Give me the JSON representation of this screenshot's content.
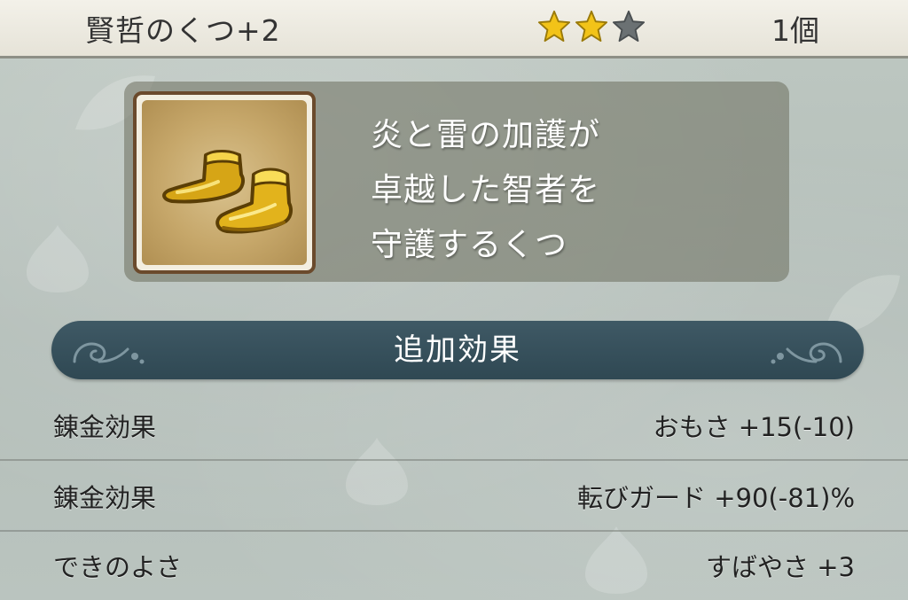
{
  "header": {
    "item_name": "賢哲のくつ+2",
    "rating": {
      "filled": 2,
      "total": 3
    },
    "quantity": "1個"
  },
  "item": {
    "icon": "golden-boots-icon",
    "description_lines": [
      "炎と雷の加護が",
      "卓越した智者を",
      "守護するくつ"
    ]
  },
  "section": {
    "title": "追加効果"
  },
  "effects": [
    {
      "label": "錬金効果",
      "value": "おもさ +15(-10)"
    },
    {
      "label": "錬金効果",
      "value": "転びガード +90(-81)%"
    },
    {
      "label": "できのよさ",
      "value": "すばやさ +3"
    }
  ],
  "colors": {
    "star_filled": "#f2c318",
    "star_empty": "#6b7173",
    "banner": "#34505b"
  }
}
